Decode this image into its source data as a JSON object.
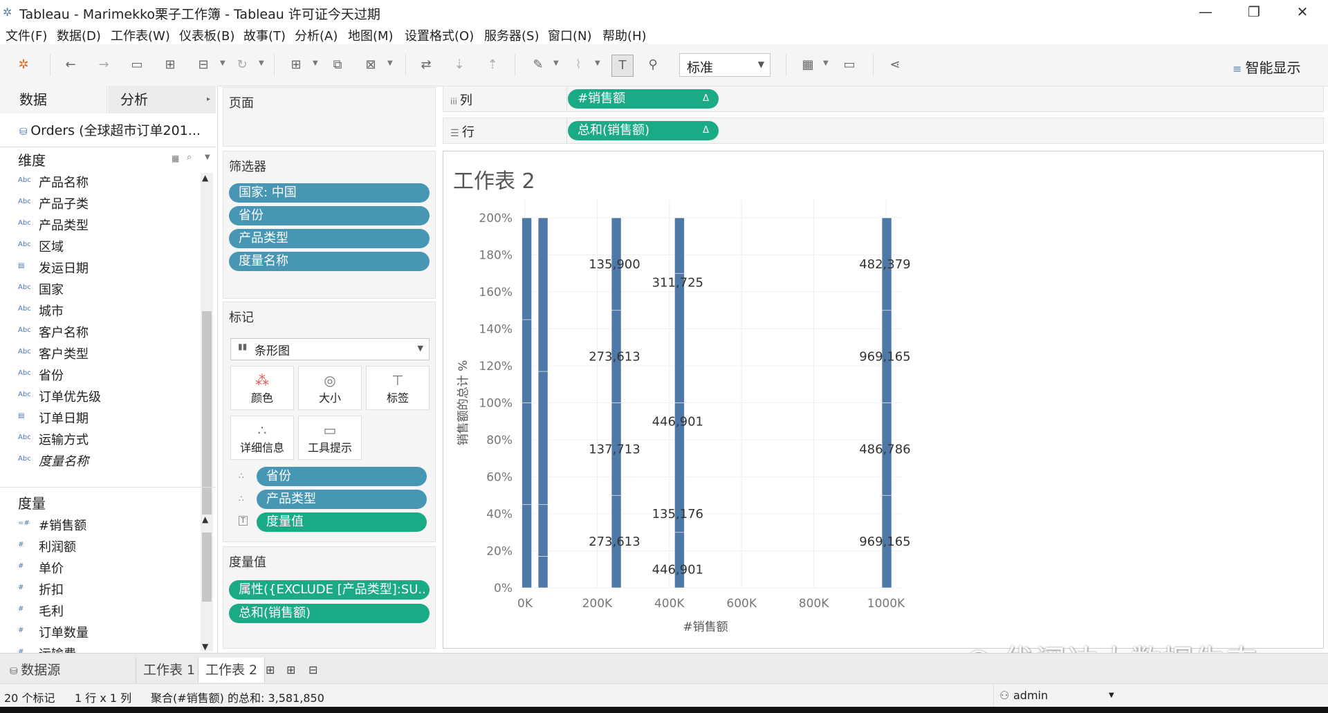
{
  "window": {
    "title": "Tableau - Marimekko栗子工作簿 - Tableau 许可证今天过期",
    "controls": [
      "—",
      "❐",
      "✕"
    ]
  },
  "menu": [
    "文件(F)",
    "数据(D)",
    "工作表(W)",
    "仪表板(B)",
    "故事(T)",
    "分析(A)",
    "地图(M)",
    "设置格式(O)",
    "服务器(S)",
    "窗口(N)",
    "帮助(H)"
  ],
  "toolbar": {
    "fit_select": "标准",
    "smart_show": "智能显示",
    "icons": [
      "tableau-logo-icon",
      "back-icon",
      "forward-icon",
      "save-icon",
      "new-datasource-icon",
      "pause-icon",
      "refresh-icon",
      "new-sheet-icon",
      "duplicate-icon",
      "clear-icon",
      "swap-icon",
      "sort-asc-icon",
      "sort-desc-icon",
      "highlight-icon",
      "group-icon",
      "label-icon",
      "pin-icon",
      "chart-type-icon",
      "presentation-icon",
      "share-icon"
    ]
  },
  "datapane": {
    "tab_data": "数据",
    "tab_analysis": "分析",
    "datasource": "Orders (全球超市订单201...",
    "dimensions_header": "维度",
    "dimensions": [
      {
        "icon": "Abc",
        "label": "产品名称"
      },
      {
        "icon": "Abc",
        "label": "产品子类"
      },
      {
        "icon": "Abc",
        "label": "产品类型"
      },
      {
        "icon": "Abc",
        "label": "区域"
      },
      {
        "icon": "cal",
        "label": "发运日期"
      },
      {
        "icon": "Abc",
        "label": "国家"
      },
      {
        "icon": "Abc",
        "label": "城市"
      },
      {
        "icon": "Abc",
        "label": "客户名称"
      },
      {
        "icon": "Abc",
        "label": "客户类型"
      },
      {
        "icon": "Abc",
        "label": "省份"
      },
      {
        "icon": "Abc",
        "label": "订单优先级"
      },
      {
        "icon": "cal",
        "label": "订单日期"
      },
      {
        "icon": "Abc",
        "label": "运输方式"
      },
      {
        "icon": "Abc",
        "label": "度量名称"
      }
    ],
    "measures_header": "度量",
    "measures": [
      {
        "icon": "=#",
        "label": "#销售额"
      },
      {
        "icon": "#",
        "label": "利润额"
      },
      {
        "icon": "#",
        "label": "单价"
      },
      {
        "icon": "#",
        "label": "折扣"
      },
      {
        "icon": "#",
        "label": "毛利"
      },
      {
        "icon": "#",
        "label": "订单数量"
      },
      {
        "icon": "#",
        "label": "运输费"
      }
    ]
  },
  "pages_card": {
    "header": "页面"
  },
  "filters_card": {
    "header": "筛选器",
    "pills": [
      "国家: 中国",
      "省份",
      "产品类型",
      "度量名称"
    ]
  },
  "marks_card": {
    "header": "标记",
    "mark_type": "条形图",
    "buttons": [
      "颜色",
      "大小",
      "标签",
      "详细信息",
      "工具提示"
    ],
    "fields": [
      {
        "icon": "∴",
        "label": "省份",
        "color": "#4696b4"
      },
      {
        "icon": "∴",
        "label": "产品类型",
        "color": "#4696b4"
      },
      {
        "icon": "T",
        "label": "度量值",
        "color": "#1aaa86"
      }
    ]
  },
  "measure_values_card": {
    "header": "度量值",
    "pills": [
      "属性({EXCLUDE [产品类型]:SU..",
      "总和(销售额)"
    ]
  },
  "shelves": {
    "columns_label": "列",
    "columns_pill": "#销售额",
    "rows_label": "行",
    "rows_pill": "总和(销售额)",
    "delta": "Δ"
  },
  "sheet": {
    "title": "工作表 2"
  },
  "chart_data": {
    "type": "bar",
    "xlabel": "#销售额",
    "ylabel": "销售额的总计 %",
    "x_ticks": [
      "0K",
      "200K",
      "400K",
      "600K",
      "800K",
      "1000K"
    ],
    "y_ticks": [
      "200%",
      "180%",
      "160%",
      "140%",
      "120%",
      "100%",
      "80%",
      "60%",
      "40%",
      "20%",
      "0%"
    ],
    "xlim": [
      0,
      1000000
    ],
    "ylim": [
      0,
      200
    ],
    "bar_color": "#4e79a7",
    "bars": [
      {
        "x": 5000,
        "segments": [
          0,
          45,
          100,
          145,
          200
        ]
      },
      {
        "x": 50000,
        "segments": [
          0,
          17,
          45,
          117,
          200
        ]
      },
      {
        "x": 253000,
        "segments": [
          0,
          50,
          100,
          150,
          200
        ]
      },
      {
        "x": 428000,
        "segments": [
          0,
          30,
          100,
          170,
          200
        ]
      },
      {
        "x": 1002000,
        "segments": [
          0,
          50,
          100,
          150,
          200
        ]
      }
    ],
    "labels": [
      {
        "text": "135,900",
        "x": 248000,
        "y": 175
      },
      {
        "text": "273,613",
        "x": 248000,
        "y": 125
      },
      {
        "text": "137,713",
        "x": 248000,
        "y": 75
      },
      {
        "text": "273,613",
        "x": 248000,
        "y": 25
      },
      {
        "text": "311,725",
        "x": 423000,
        "y": 165
      },
      {
        "text": "446,901",
        "x": 423000,
        "y": 90
      },
      {
        "text": "135,176",
        "x": 423000,
        "y": 40
      },
      {
        "text": "446,901",
        "x": 423000,
        "y": 10
      },
      {
        "text": "482,379",
        "x": 997000,
        "y": 175
      },
      {
        "text": "969,165",
        "x": 997000,
        "y": 125
      },
      {
        "text": "486,786",
        "x": 997000,
        "y": 75
      },
      {
        "text": "969,165",
        "x": 997000,
        "y": 25
      }
    ]
  },
  "sheet_tabs": {
    "datasource": "数据源",
    "tabs": [
      "工作表 1",
      "工作表 2"
    ],
    "active_index": 1
  },
  "status": {
    "marks": "20 个标记",
    "rowscols": "1 行 x 1 列",
    "sum": "聚合(#销售额) 的总和: 3,581,850",
    "user": "admin"
  },
  "watermark": "优阅达大数据生态"
}
